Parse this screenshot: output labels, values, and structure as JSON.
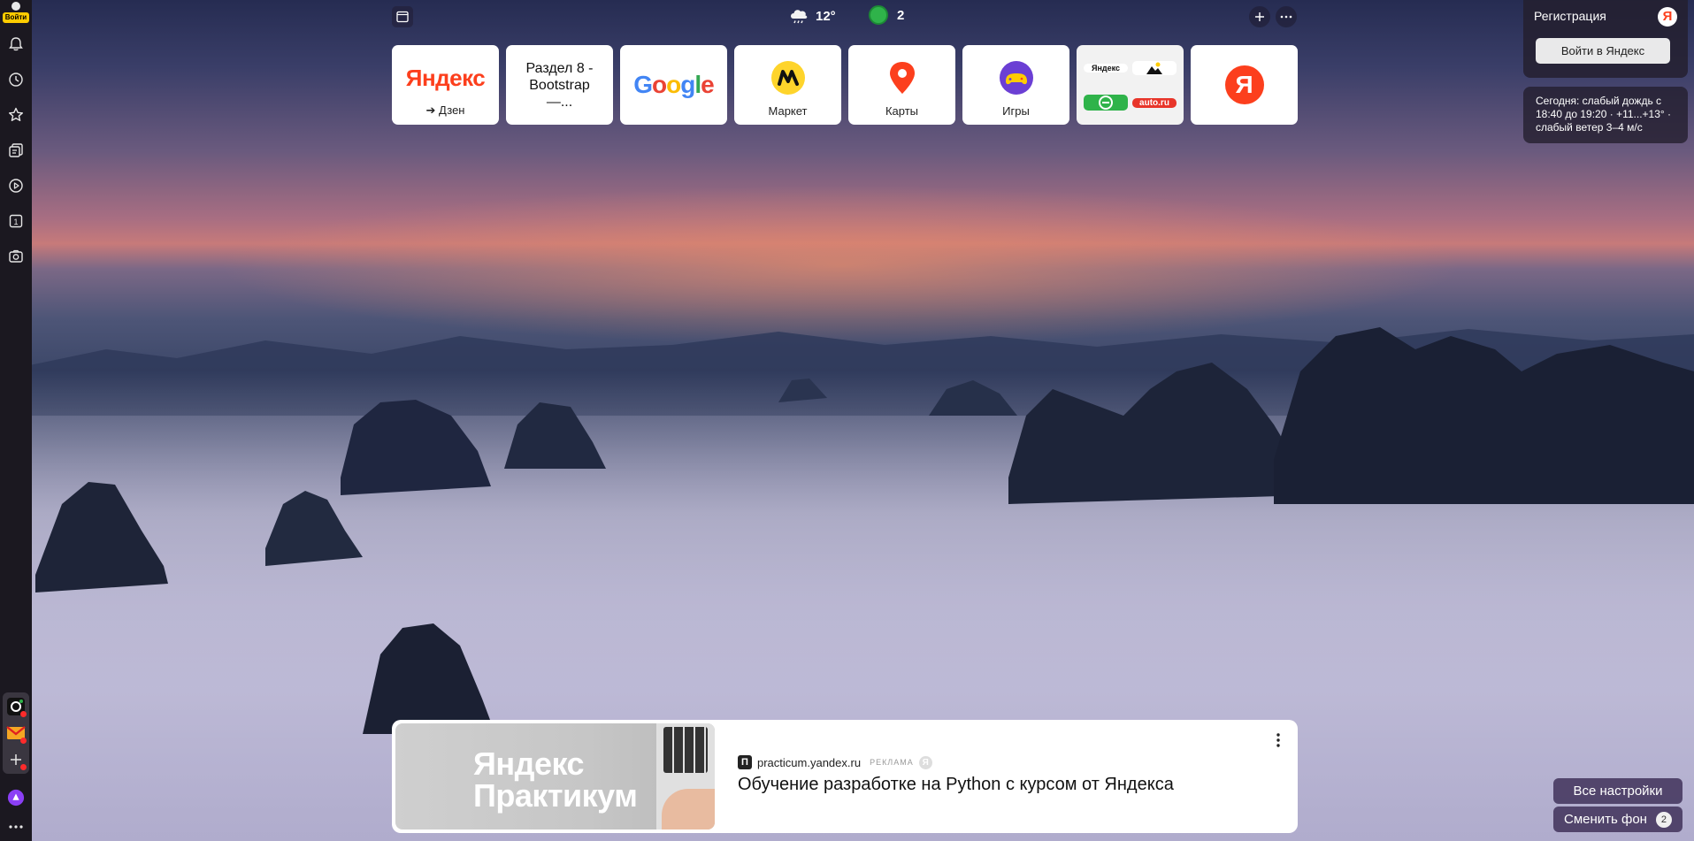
{
  "sidebar": {
    "login_label": "Войти",
    "icons": [
      "bell-icon",
      "history-icon",
      "star-icon",
      "collections-icon",
      "video-icon",
      "tab-count-icon",
      "screenshot-icon"
    ],
    "tab_count": "1",
    "apps": [
      "dzen-app",
      "mail-app",
      "add-app"
    ]
  },
  "topbar": {
    "weather_temp": "12°",
    "traffic_score": "2"
  },
  "tiles": [
    {
      "type": "yandex",
      "logo": "Яндекс",
      "caption": "➔ Дзен"
    },
    {
      "type": "text",
      "title": "Раздел 8 - Bootstrap —..."
    },
    {
      "type": "google",
      "logo": "Google"
    },
    {
      "type": "market",
      "caption": "Маркет"
    },
    {
      "type": "maps",
      "caption": "Карты"
    },
    {
      "type": "games",
      "caption": "Игры"
    },
    {
      "type": "group",
      "items": [
        "Яндекс",
        "",
        "",
        "auto.ru"
      ]
    },
    {
      "type": "yandex-logo",
      "logo": "Я"
    }
  ],
  "account": {
    "register_label": "Регистрация",
    "ya_logo": "Я",
    "login_button": "Войти в Яндекс",
    "forecast": "Сегодня: слабый дождь с 18:40 до 19:20 · +11...+13° · слабый ветер 3–4 м/с"
  },
  "ad": {
    "brand": "Яндекс Практикум",
    "favicon": "П",
    "source": "practicum.yandex.ru",
    "badge": "РЕКЛАМА",
    "ya_mark": "Я",
    "title": "Обучение разработке на Python с курсом от Яндекса"
  },
  "bottom": {
    "settings_label": "Все настройки",
    "change_bg_label": "Сменить фон",
    "change_bg_count": "2"
  },
  "colors": {
    "yandex_red": "#fc3f1d",
    "sidebar_bg": "#1b1820",
    "login_yellow": "#ffcc00",
    "traffic_green": "#2fb34a"
  }
}
